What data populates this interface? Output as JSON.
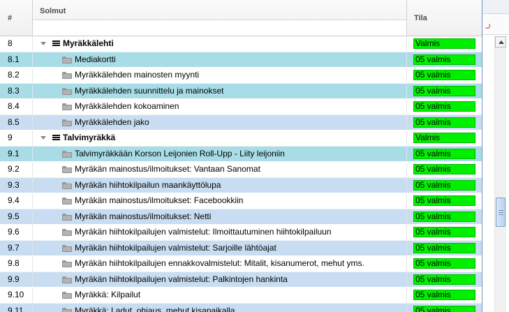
{
  "header": {
    "col_num": "#",
    "col_nodes": "Solmut",
    "col_state": "Tila"
  },
  "rows": [
    {
      "num": "8",
      "label": "Myräkkälehti",
      "state": "Valmis",
      "type": "parent"
    },
    {
      "num": "8.1",
      "label": "Mediakortti",
      "state": "05 valmis",
      "type": "child"
    },
    {
      "num": "8.2",
      "label": "Myräkkälehden mainosten myynti",
      "state": "05 valmis",
      "type": "child"
    },
    {
      "num": "8.3",
      "label": "Myräkkälehden suunnittelu ja mainokset",
      "state": "05 valmis",
      "type": "child"
    },
    {
      "num": "8.4",
      "label": "Myräkkälehden kokoaminen",
      "state": "05 valmis",
      "type": "child"
    },
    {
      "num": "8.5",
      "label": "Myräkkälehden jako",
      "state": "05 valmis",
      "type": "child"
    },
    {
      "num": "9",
      "label": "Talvimyräkkä",
      "state": "Valmis",
      "type": "parent"
    },
    {
      "num": "9.1",
      "label": "Talvimyräkkään Korson Leijonien Roll-Upp - Liity leijoniin",
      "state": "05 valmis",
      "type": "child"
    },
    {
      "num": "9.2",
      "label": "Myräkän mainostus/ilmoitukset: Vantaan Sanomat",
      "state": "05 valmis",
      "type": "child"
    },
    {
      "num": "9.3",
      "label": "Myräkän hiihtokilpailun maankäyttölupa",
      "state": "05 valmis",
      "type": "child"
    },
    {
      "num": "9.4",
      "label": "Myräkän mainostus/ilmoitukset: Facebookkiin",
      "state": "05 valmis",
      "type": "child"
    },
    {
      "num": "9.5",
      "label": "Myräkän mainostus/ilmoitukset: Netti",
      "state": "05 valmis",
      "type": "child"
    },
    {
      "num": "9.6",
      "label": "Myräkän hiihtokilpailujen valmistelut: Ilmoittautuminen hiihtokilpailuun",
      "state": "05 valmis",
      "type": "child"
    },
    {
      "num": "9.7",
      "label": "Myräkän hiihtokilpailujen valmistelut: Sarjoille lähtöajat",
      "state": "05 valmis",
      "type": "child"
    },
    {
      "num": "9.8",
      "label": "Myräkän hiihtokilpailujen ennakkovalmistelut: Mitalit, kisanumerot, mehut yms.",
      "state": "05 valmis",
      "type": "child"
    },
    {
      "num": "9.9",
      "label": "Myräkän hiihtokilpailujen valmistelut: Palkintojen hankinta",
      "state": "05 valmis",
      "type": "child"
    },
    {
      "num": "9.10",
      "label": "Myräkkä: Kilpailut",
      "state": "05 valmis",
      "type": "child"
    },
    {
      "num": "9.11",
      "label": "Myräkkä: Ladut, ohjaus, mehut kisapaikalla",
      "state": "05 valmis",
      "type": "child"
    }
  ],
  "colors": {
    "status_green": "#00f000",
    "row_alt": "#c8ddf1",
    "row_highlight": "#a8dce6"
  },
  "icons": {
    "parent": "list-icon",
    "child": "folder-icon",
    "expand": "triangle-down-icon"
  }
}
